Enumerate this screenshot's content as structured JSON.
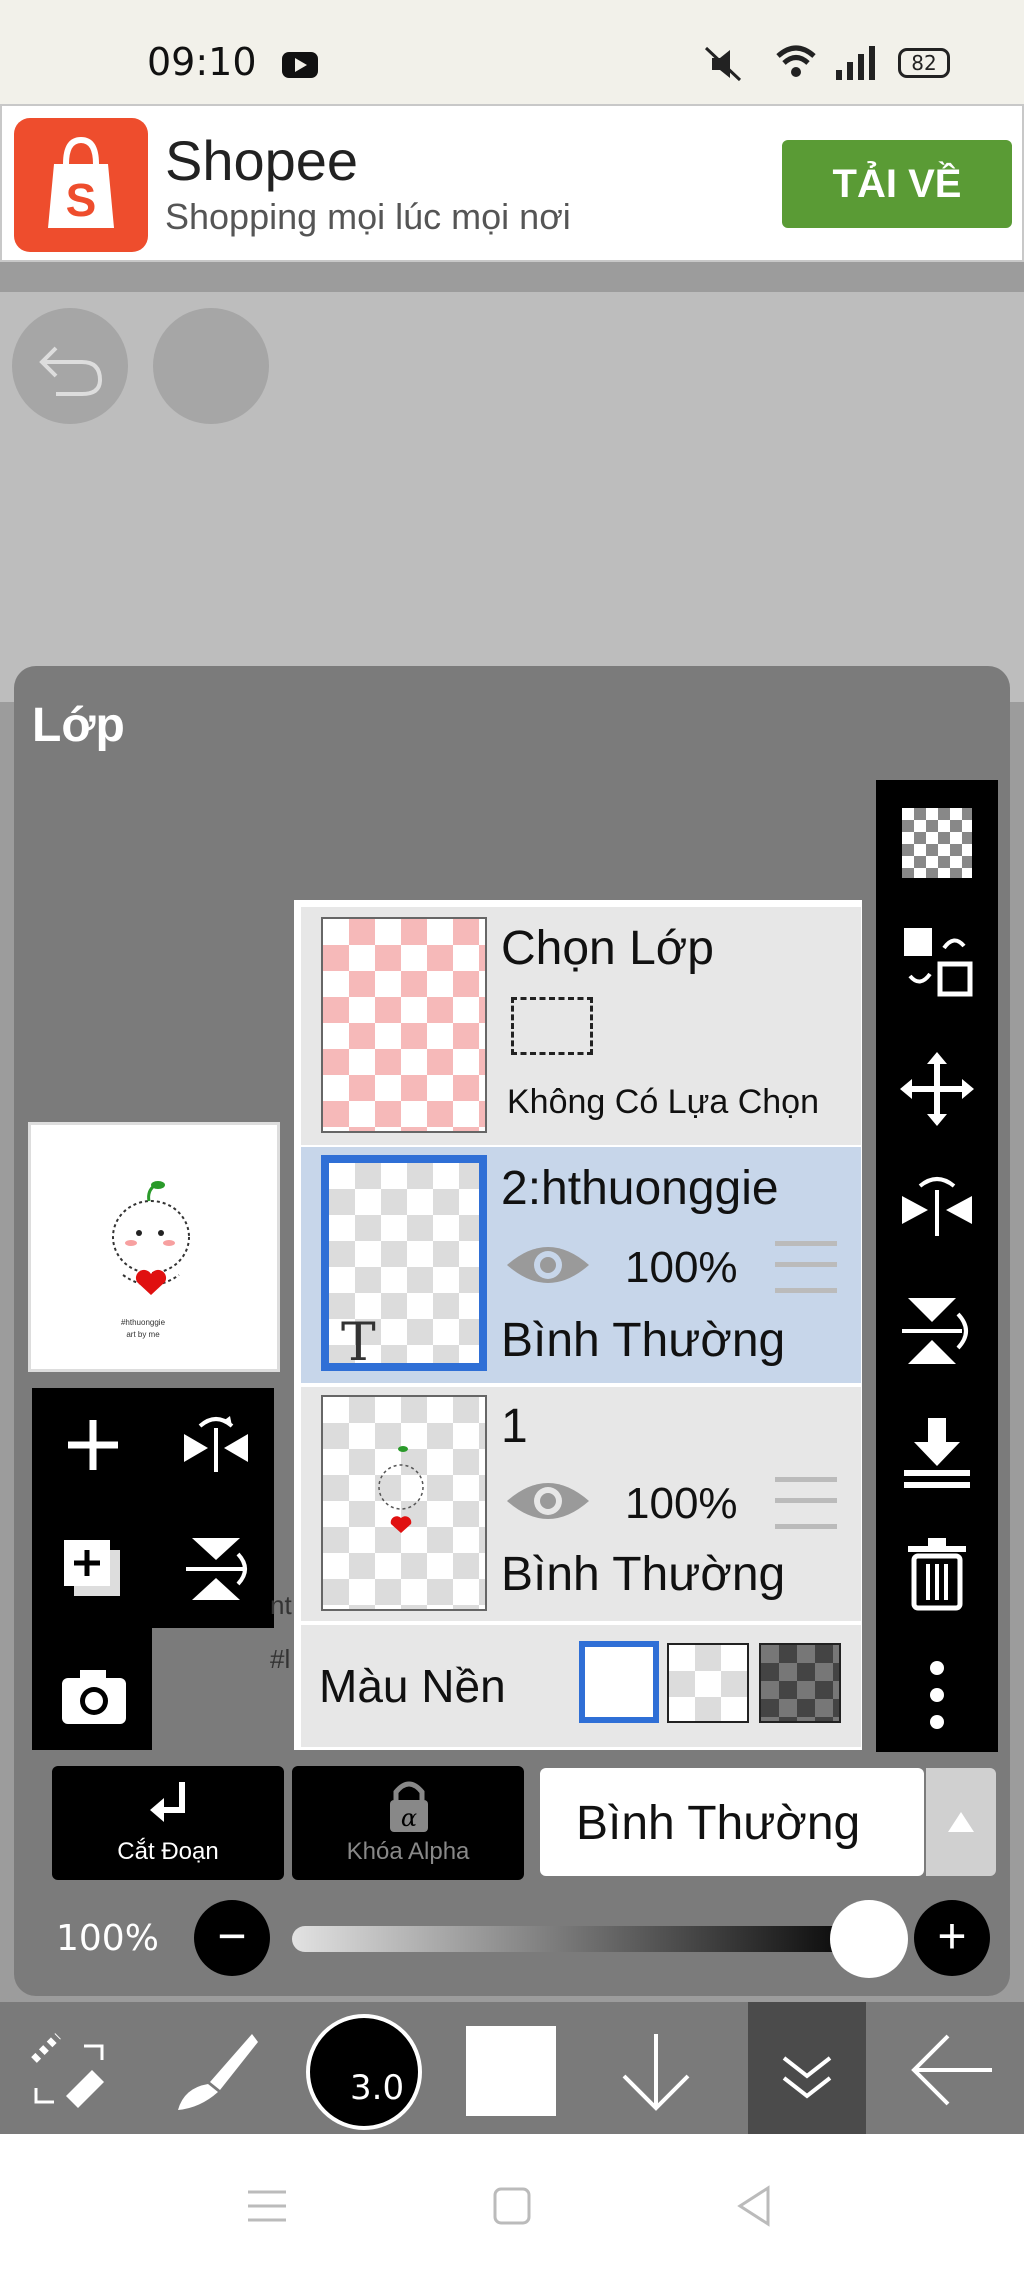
{
  "status_bar": {
    "time": "09:10",
    "battery": "82"
  },
  "ad": {
    "title": "Shopee",
    "subtitle": "Shopping mọi lúc mọi nơi",
    "cta": "TẢI VỀ"
  },
  "panel": {
    "title": "Lớp"
  },
  "background_text": {
    "line1": "nt",
    "line2": "#l"
  },
  "layers": {
    "selection": {
      "title": "Chọn Lớp",
      "status": "Không Có Lựa Chọn"
    },
    "items": [
      {
        "name": "2:hthuonggie",
        "opacity": "100%",
        "blend": "Bình Thường",
        "selected": true
      },
      {
        "name": "1",
        "opacity": "100%",
        "blend": "Bình Thường",
        "selected": false
      }
    ],
    "background": {
      "label": "Màu Nền"
    }
  },
  "controls": {
    "clipping_label": "Cắt Đoạn",
    "alpha_lock_label": "Khóa Alpha",
    "blend_mode": "Bình Thường",
    "opacity_label": "100%"
  },
  "toolbar": {
    "brush_size": "3.0"
  },
  "preview_text": {
    "line1": "#hthuonggie",
    "line2": "art by me"
  }
}
